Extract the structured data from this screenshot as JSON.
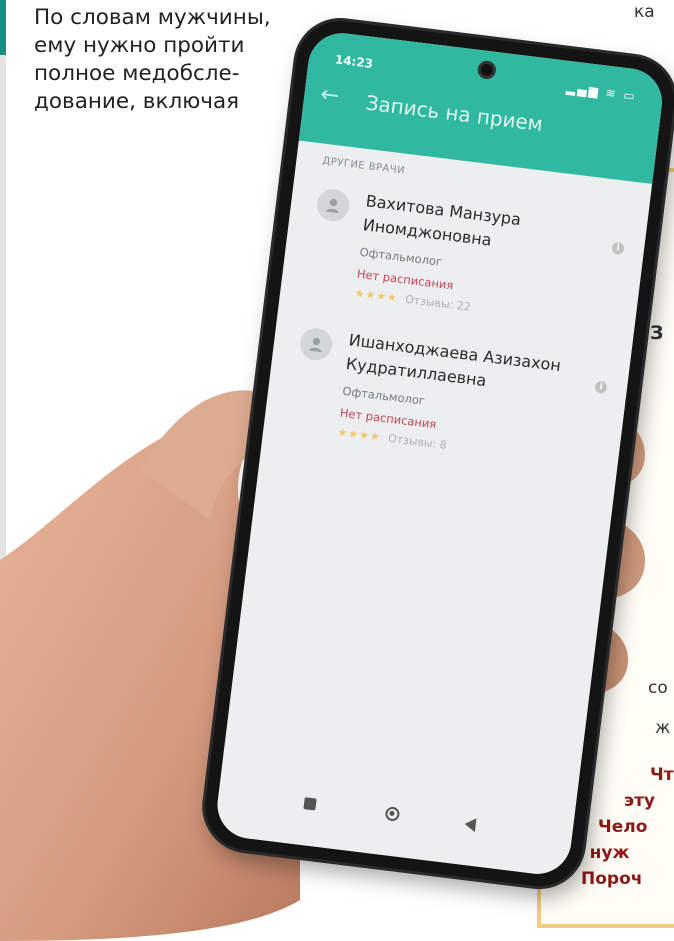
{
  "article": {
    "lines": [
      "По словам мужчины,",
      "ему нужно пройти",
      "полное медобсле-",
      "дование, включая"
    ],
    "top_fragment": "ка"
  },
  "sidebar": {
    "fragments": [
      "З",
      "со",
      "ж"
    ],
    "question_lines": [
      "Чт",
      "эту",
      "Чело",
      "в нуж",
      "Пороч"
    ]
  },
  "phone": {
    "status_time": "14:23",
    "app_title": "Запись на прием",
    "section_label": "Другие врачи",
    "doctors": [
      {
        "name": "Вахитова Манзура Иномджоновна",
        "specialty": "Офтальмолог",
        "schedule": "Нет расписания",
        "stars": "★★★★",
        "reviews": "Отзывы: 22"
      },
      {
        "name": "Ишанходжаева Азизахон Кудратиллаевна",
        "specialty": "Офтальмолог",
        "schedule": "Нет расписания",
        "stars": "★★★★",
        "reviews": "Отзывы: 8"
      }
    ],
    "info_glyph": "i"
  },
  "colors": {
    "app_bar": "#30b9a0",
    "sidebar_border": "#f2cf7a",
    "question_text": "#8b1a1a",
    "schedule_text": "#c0445a",
    "margin_accent": "#1f8c84"
  }
}
